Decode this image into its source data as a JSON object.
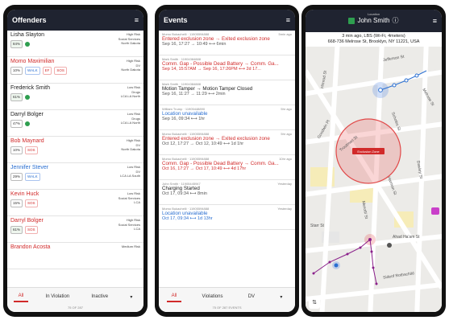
{
  "offenders": {
    "title": "Offenders",
    "menu_icon": "≡",
    "rows": [
      {
        "name": "Lisha Slayton",
        "style": "",
        "risk": "High Risk",
        "cat": "Social Services",
        "region": "North Dakota",
        "tags": [
          {
            "t": "84%",
            "c": "batt"
          },
          {
            "t": "●",
            "c": "dot"
          }
        ]
      },
      {
        "name": "Momo Maximilian",
        "style": "red",
        "risk": "High Risk",
        "cat": "DV",
        "region": "North Dakota",
        "tags": [
          {
            "t": "10%",
            "c": ""
          },
          {
            "t": "WALK",
            "c": "blue"
          },
          {
            "t": "EF",
            "c": "red"
          },
          {
            "t": "SOS",
            "c": "red"
          }
        ]
      },
      {
        "name": "Frederick Smith",
        "style": "",
        "risk": "Low Risk",
        "cat": "Drugs",
        "region": "LCA LA North",
        "tags": [
          {
            "t": "61%",
            "c": "batt"
          },
          {
            "t": "●",
            "c": "dot"
          }
        ]
      },
      {
        "name": "Darryl Bolger",
        "style": "",
        "risk": "Low Risk",
        "cat": "Drugs",
        "region": "LCA LA North",
        "tags": [
          {
            "t": "47%",
            "c": ""
          },
          {
            "t": "●",
            "c": "dot"
          }
        ]
      },
      {
        "name": "Bob Maynard",
        "style": "red",
        "risk": "High Risk",
        "cat": "DV",
        "region": "North Dakota",
        "tags": [
          {
            "t": "10%",
            "c": ""
          },
          {
            "t": "SOS",
            "c": "red"
          }
        ]
      },
      {
        "name": "Jennifer Stever",
        "style": "blue",
        "risk": "Low Risk",
        "cat": "DV",
        "region": "LCA LA South",
        "tags": [
          {
            "t": "29%",
            "c": ""
          },
          {
            "t": "WALK",
            "c": "blue"
          }
        ]
      },
      {
        "name": "Kevin Huck",
        "style": "red",
        "risk": "Low Risk",
        "cat": "Social Services",
        "region": "LCA",
        "tags": [
          {
            "t": "15%",
            "c": ""
          },
          {
            "t": "SOS",
            "c": "red"
          }
        ]
      },
      {
        "name": "Darryl Bolger",
        "style": "red",
        "risk": "High Risk",
        "cat": "Social Services",
        "region": "LCA",
        "tags": [
          {
            "t": "61%",
            "c": "batt"
          },
          {
            "t": "SOS",
            "c": "red"
          }
        ]
      },
      {
        "name": "Brandon Acosta",
        "style": "red",
        "risk": "Medium Risk",
        "cat": "",
        "region": "",
        "tags": []
      }
    ],
    "tabs": [
      "All",
      "In Violation",
      "Inactive",
      "▾"
    ],
    "count": "75 OF 287"
  },
  "events": {
    "title": "Events",
    "menu_icon": "≡",
    "items": [
      {
        "who": "Momo Bukachelli · 11905594888",
        "ago": "5min ago",
        "title": "Entered exclusion zone → Exited exclusion zone",
        "tstyle": "red",
        "time": "Sep 16, 17:27 → 10:49 ⟷ 6min",
        "mstyle": ""
      },
      {
        "who": "Mark Smith · 11904384888",
        "ago": "",
        "title": "Comm. Gap - Possible Dead Battery → Comm. Ga...",
        "tstyle": "red",
        "time": "Sep 14, 15:57AM → Sep 16, 17:26PM ⟷ 2d 17...",
        "mstyle": "red"
      },
      {
        "who": "Mark Smith · 11904384888",
        "ago": "",
        "title": "Motion Tamper → Motion Tamper Closed",
        "tstyle": "",
        "time": "Sep 16, 11:27 → 11:29 ⟷ 2min",
        "mstyle": ""
      },
      {
        "who": "William Trump · 11905448890",
        "ago": "5hr ago",
        "title": "Location unavailable",
        "tstyle": "blue",
        "time": "Sep 16, 09:34 ⟷ 1hr",
        "mstyle": ""
      },
      {
        "who": "Momo Bukachelli · 11905594888",
        "ago": "5hr ago",
        "title": "Entered exclusion zone → Exited exclusion zone",
        "tstyle": "red",
        "time": "Oct 12, 17:27 → Oct 12, 10:49 ⟷ 1d 1hr",
        "mstyle": ""
      },
      {
        "who": "Momo Bukachelli · 11905594888",
        "ago": "10hr ago",
        "title": "Comm. Gap - Possible Dead Battery → Comm. Ga...",
        "tstyle": "red",
        "time": "Oct 16, 17:27 → Oct 17, 10:49 ⟷ 4d 17hr",
        "mstyle": "red"
      },
      {
        "who": "John Smith · 11905445947",
        "ago": "Yesterday",
        "title": "Charging Started",
        "tstyle": "",
        "time": "Oct 17, 09:34 ⟷ 8min",
        "mstyle": ""
      },
      {
        "who": "Momo Bukachelli · 11905594888",
        "ago": "Yesterday",
        "title": "Location unavailable",
        "tstyle": "blue",
        "time": "Oct 17, 09:34 ⟷ 1d 13hr",
        "mstyle": "blue"
      }
    ],
    "tabs": [
      "All",
      "Violations",
      "DV",
      "▾"
    ],
    "count": "75 OF 287 EVENTS"
  },
  "map": {
    "label": "Location",
    "name": "John Smith",
    "info_icon": "ⓘ",
    "menu_icon": "≡",
    "addr_line1": "3 min ago, LBS (Wi-Fi, 4meters)",
    "addr_line2": "668-736 Melrose St, Brooklyn, NY 11221, USA",
    "zone_label": "Exclusion Zone",
    "streets": [
      "Jefferson St",
      "Troutman St",
      "Scholes St",
      "Goodwin Pl",
      "Harman St",
      "Ahad Ha'am St",
      "Menotti St",
      "Sideof Rothschild",
      "Dawley St",
      "Starr St",
      "Himrod St",
      "Melrose St"
    ]
  }
}
